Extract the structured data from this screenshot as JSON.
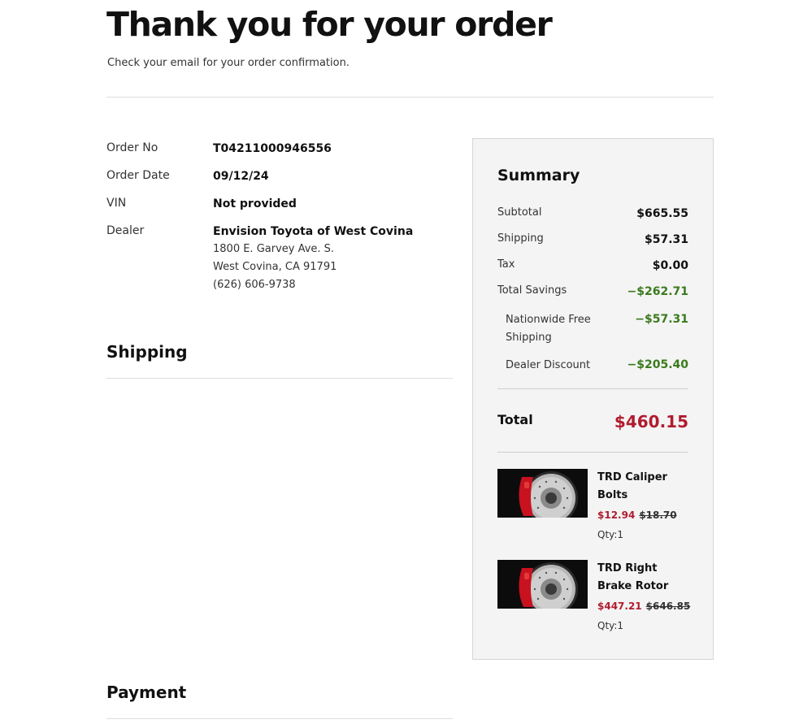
{
  "header": {
    "title": "Thank you for your order",
    "subtitle": "Check your email for your order confirmation."
  },
  "order": {
    "order_no_label": "Order No",
    "order_no": "T04211000946556",
    "order_date_label": "Order Date",
    "order_date": "09/12/24",
    "vin_label": "VIN",
    "vin": "Not provided",
    "dealer_label": "Dealer",
    "dealer_name": "Envision Toyota of West Covina",
    "dealer_address_1": "1800 E. Garvey Ave. S.",
    "dealer_address_2": "West Covina, CA 91791",
    "dealer_phone": "(626) 606-9738"
  },
  "sections": {
    "shipping": "Shipping",
    "payment": "Payment"
  },
  "summary": {
    "title": "Summary",
    "subtotal_label": "Subtotal",
    "subtotal": "$665.55",
    "shipping_label": "Shipping",
    "shipping": "$57.31",
    "tax_label": "Tax",
    "tax": "$0.00",
    "savings_label": "Total Savings",
    "savings": "−$262.71",
    "free_shipping_label": "Nationwide Free Shipping",
    "free_shipping": "−$57.31",
    "dealer_discount_label": "Dealer Discount",
    "dealer_discount": "−$205.40",
    "total_label": "Total",
    "total": "$460.15"
  },
  "items": [
    {
      "name": "TRD Caliper Bolts",
      "price": "$12.94",
      "original_price": "$18.70",
      "qty": "Qty:1",
      "image_icon": "brake-rotor-image"
    },
    {
      "name": "TRD Right Brake Rotor",
      "price": "$447.21",
      "original_price": "$646.85",
      "qty": "Qty:1",
      "image_icon": "brake-rotor-image"
    }
  ],
  "colors": {
    "accent_red": "#b01c2e",
    "savings_green": "#3b7a1d",
    "summary_bg": "#f4f4f4"
  }
}
